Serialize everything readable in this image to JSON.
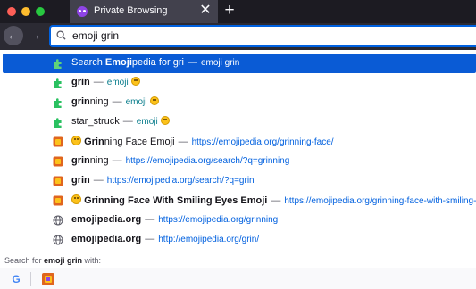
{
  "tab": {
    "title": "Private Browsing"
  },
  "urlbar": {
    "value": "emoji grin"
  },
  "results": [
    {
      "type": "search",
      "prefix": "Search ",
      "bold": "Emoji",
      "rest": "pedia for gri",
      "action": "emoji grin"
    },
    {
      "type": "keyword",
      "bold": "grin",
      "rest": "",
      "action": "emoji"
    },
    {
      "type": "keyword",
      "bold": "grin",
      "rest": "ning",
      "action": "emoji"
    },
    {
      "type": "keyword",
      "bold": "",
      "rest": "star_struck",
      "action": "emoji"
    },
    {
      "type": "bookmark",
      "bold": "Grin",
      "rest": "ning Face Emoji",
      "url": "https://emojipedia.org/grinning-face/"
    },
    {
      "type": "bookmark",
      "bold": "grin",
      "rest": "ning",
      "url": "https://emojipedia.org/search/?q=grinning"
    },
    {
      "type": "bookmark",
      "bold": "grin",
      "rest": "",
      "url": "https://emojipedia.org/search/?q=grin"
    },
    {
      "type": "bookmark",
      "bold": "Grin",
      "rest": "ning Face With Smiling Eyes Emoji",
      "url": "https://emojipedia.org/grinning-face-with-smiling-eyes/"
    },
    {
      "type": "history",
      "bold": "emojipedia",
      "rest": ".org",
      "url": "https://emojipedia.org/grinning"
    },
    {
      "type": "history",
      "bold": "emojipedia",
      "rest": ".org",
      "url": "http://emojipedia.org/grin/"
    }
  ],
  "one_offs": {
    "label_prefix": "Search for ",
    "query": "emoji grin",
    "label_suffix": " with:",
    "google_glyph": "G"
  },
  "colors": {
    "accent": "#0061e0",
    "selected": "#0a5bd5",
    "url": "#0060df",
    "action": "#0a7d8c"
  },
  "icons": [
    "private-browsing-icon",
    "close-icon",
    "plus-icon",
    "back-icon",
    "forward-icon",
    "search-icon",
    "extension-icon",
    "emojipedia-favicon",
    "globe-icon",
    "google-icon"
  ]
}
